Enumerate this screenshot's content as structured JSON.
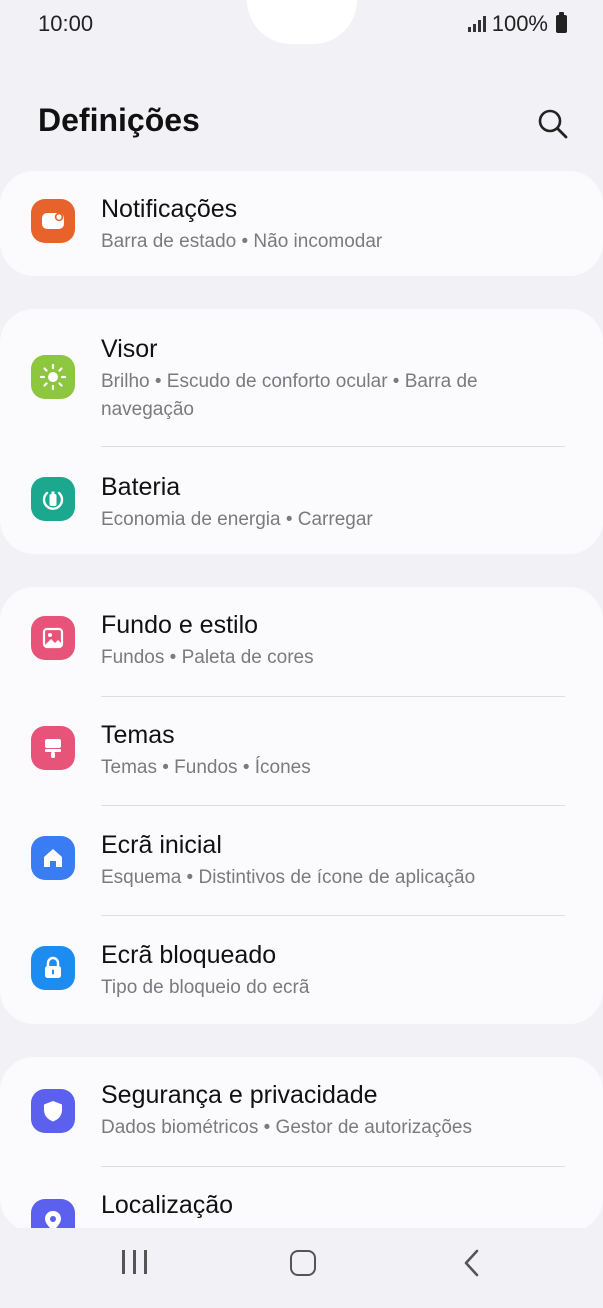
{
  "status_bar": {
    "time": "10:00",
    "battery_text": "100%"
  },
  "header": {
    "title": "Definições",
    "search_icon": "search-icon"
  },
  "groups": [
    {
      "items": [
        {
          "title": "Notificações",
          "subtitle": "Barra de estado  •  Não incomodar",
          "icon": "notifications-icon",
          "color": "#e8622c"
        }
      ]
    },
    {
      "items": [
        {
          "title": "Visor",
          "subtitle": "Brilho  •  Escudo de conforto ocular  •  Barra de navegação",
          "icon": "brightness-icon",
          "color": "#8dc63f"
        },
        {
          "title": "Bateria",
          "subtitle": "Economia de energia  •  Carregar",
          "icon": "battery-icon",
          "color": "#1ca88e"
        }
      ]
    },
    {
      "items": [
        {
          "title": "Fundo e estilo",
          "subtitle": "Fundos  •  Paleta de cores",
          "icon": "wallpaper-icon",
          "color": "#e8537a"
        },
        {
          "title": "Temas",
          "subtitle": "Temas  •  Fundos  •  Ícones",
          "icon": "paintbrush-icon",
          "color": "#e8537a"
        },
        {
          "title": "Ecrã inicial",
          "subtitle": "Esquema  •  Distintivos de ícone de aplicação",
          "icon": "home-icon",
          "color": "#3a7cf4"
        },
        {
          "title": "Ecrã bloqueado",
          "subtitle": "Tipo de bloqueio do ecrã",
          "icon": "lock-icon",
          "color": "#1d8cf0"
        }
      ]
    },
    {
      "items": [
        {
          "title": "Segurança e privacidade",
          "subtitle": "Dados biométricos  •  Gestor de autorizações",
          "icon": "shield-icon",
          "color": "#5b61ee"
        },
        {
          "title": "Localização",
          "subtitle": "",
          "icon": "location-pin-icon",
          "color": "#5b61ee"
        }
      ]
    }
  ],
  "nav_bar": {
    "recent_icon": "recent-apps-icon",
    "home_icon": "home-button-icon",
    "back_icon": "back-icon"
  }
}
